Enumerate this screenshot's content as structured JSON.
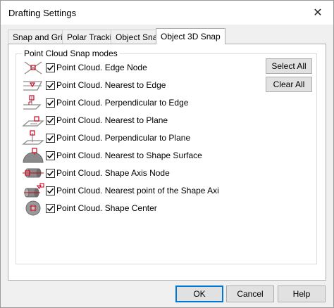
{
  "window": {
    "title": "Drafting Settings"
  },
  "tabs": [
    {
      "label": "Snap and Grid",
      "active": false
    },
    {
      "label": "Polar Tracking",
      "active": false
    },
    {
      "label": "Object Snap",
      "active": false
    },
    {
      "label": "Object 3D Snap",
      "active": true
    }
  ],
  "group": {
    "legend": "Point Cloud Snap modes",
    "items": [
      {
        "label": "Point Cloud. Edge Node",
        "checked": true,
        "icon": "edge-node-icon"
      },
      {
        "label": "Point Cloud. Nearest to Edge",
        "checked": true,
        "icon": "nearest-to-edge-icon"
      },
      {
        "label": "Point Cloud. Perpendicular to Edge",
        "checked": true,
        "icon": "perpendicular-to-edge-icon"
      },
      {
        "label": "Point Cloud. Nearest to Plane",
        "checked": true,
        "icon": "nearest-to-plane-icon"
      },
      {
        "label": "Point Cloud. Perpendicular to Plane",
        "checked": true,
        "icon": "perpendicular-to-plane-icon"
      },
      {
        "label": "Point Cloud. Nearest to Shape Surface",
        "checked": true,
        "icon": "nearest-to-shape-surface-icon"
      },
      {
        "label": "Point Cloud. Shape Axis Node",
        "checked": true,
        "icon": "shape-axis-node-icon"
      },
      {
        "label": "Point Cloud. Nearest point of the Shape Axi",
        "checked": true,
        "icon": "nearest-point-shape-axis-icon"
      },
      {
        "label": "Point Cloud. Shape Center",
        "checked": true,
        "icon": "shape-center-icon"
      }
    ]
  },
  "buttons": {
    "select_all": "Select All",
    "clear_all": "Clear All",
    "ok": "OK",
    "cancel": "Cancel",
    "help": "Help"
  },
  "colors": {
    "accent": "#0078d7",
    "snap_marker": "#d0021b",
    "icon_gray": "#8a8a8a"
  }
}
